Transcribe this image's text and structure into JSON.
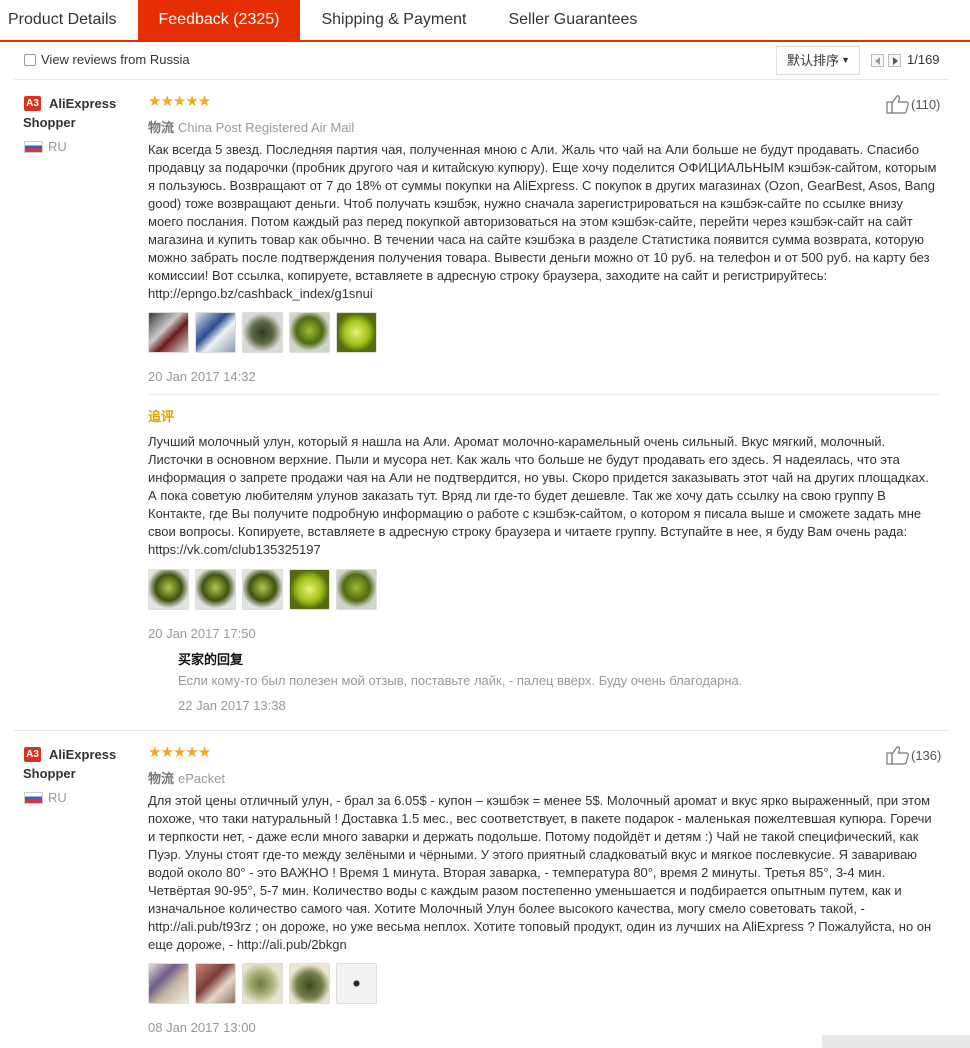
{
  "tabs": [
    {
      "label": "Product Details",
      "active": false
    },
    {
      "label": "Feedback (2325)",
      "active": true
    },
    {
      "label": "Shipping & Payment",
      "active": false
    },
    {
      "label": "Seller Guarantees",
      "active": false
    }
  ],
  "filter": {
    "checkbox_label": "View reviews from Russia",
    "checked": false,
    "sort_label": "默认排序",
    "page_indicator": "1/169"
  },
  "shipping_key": "物流",
  "reviews": [
    {
      "avatar": "A3",
      "user": "AliExpress Shopper",
      "country": "RU",
      "stars": "★★★★★",
      "shipping": "China Post Registered Air Mail",
      "likes": "(110)",
      "text": "Как всегда 5 звезд. Последняя партия чая, полученная мною с Али. Жаль что чай на Али больше не будут продавать. Спасибо продавцу за подарочки (пробник другого чая и китайскую купюру). Еще хочу поделится ОФИЦИАЛЬНЫМ кэшбэк-сайтом, которым я пользуюсь. Возвращают от 7 до 18% от суммы покупки на AliExpress. С покупок в других магазинах (Ozon, GearBest, Asos, Bang good) тоже возвращают деньги. Чтоб получать кэшбэк, нужно сначала зарегистрироваться на кэшбэк-сайте по ссылке внизу моего послания. Потом каждый раз перед покупкой авторизоваться на этом кэшбэк-сайте, перейти через кэшбэк-сайт на сайт магазина и купить товар как обычно. В течении часа на сайте кэшбэка в разделе Статистика появится сумма возврата, которую можно забрать после подтверждения получения товара. Вывести деньги можно от 10 руб. на телефон и от 500 руб. на карту без комиссии! Вот ссылка, копируете, вставляете в адресную строку браузера, заходите на сайт и регистрируйтесь: http://epngo.bz/cashback_index/g1snui",
      "date": "20 Jan 2017 14:32",
      "additional_label": "追评",
      "additional_text": "Лучший молочный улун, который я нашла на Али. Аромат молочно-карамельный очень сильный. Вкус мягкий, молочный. Листочки в основном верхние. Пыли и мусора нет. Как жаль что больше не будут продавать его здесь. Я надеялась, что эта информация о запрете продажи чая на Али не подтвердится, но увы. Скоро придется заказывать этот чай на других площадках. А пока советую любителям улунов заказать тут. Вряд ли где-то будет дешевле. Так же хочу дать ссылку на свою группу В Контакте, где Вы получите подробную информацию о работе с кэшбэк-сайтом, о котором я писала выше и сможете задать мне свои вопросы. Копируете, вставляете в адресную строку браузера и читаете группу. Вступайте в нее, я буду Вам очень рада: https://vk.com/club135325197",
      "additional_date": "20 Jan 2017 17:50",
      "reply_title": "买家的回复",
      "reply_text": "Если кому-то был полезен мой отзыв, поставьте лайк, - палец вверх. Буду очень благодарна.",
      "reply_date": "22 Jan 2017 13:38"
    },
    {
      "avatar": "A3",
      "user": "AliExpress Shopper",
      "country": "RU",
      "stars": "★★★★★",
      "shipping": "ePacket",
      "likes": "(136)",
      "text": "Для этой цены отличный улун, - брал за 6.05$ - купон – кэшбэк = менее 5$. Молочный аромат и вкус ярко выраженный, при этом похоже, что таки натуральный ! Доставка 1.5 мес., вес соответствует, в пакете подарок - маленькая пожелтевшая купюра. Горечи и терпкости нет, - даже если много заварки и держать подольше. Потому подойдёт и детям :) Чай не такой специфический, как Пуэр. Улуны стоят где-то между зелёными и чёрными. У этого приятный сладковатый вкус и мягкое послевкусие. Я завариваю водой около 80° - это ВАЖНО ! Время 1 минута. Вторая заварка, - температура 80°, время 2 минуты. Третья 85°, 3-4 мин. Четвёртая 90-95°, 5-7 мин. Количество воды с каждым разом постепенно уменьшается и подбирается опытным путем, как и изначальное количество самого чая. Хотите Молочный Улун более высокого качества, могу смело советовать такой, - http://ali.pub/t93rz ; он дороже, но уже весьма неплох. Хотите топовый продукт, один из лучших на AliExpress ? Пожалуйста, но он еще дороже, - http://ali.pub/2bkgn",
      "date": "08 Jan 2017 13:00"
    }
  ]
}
